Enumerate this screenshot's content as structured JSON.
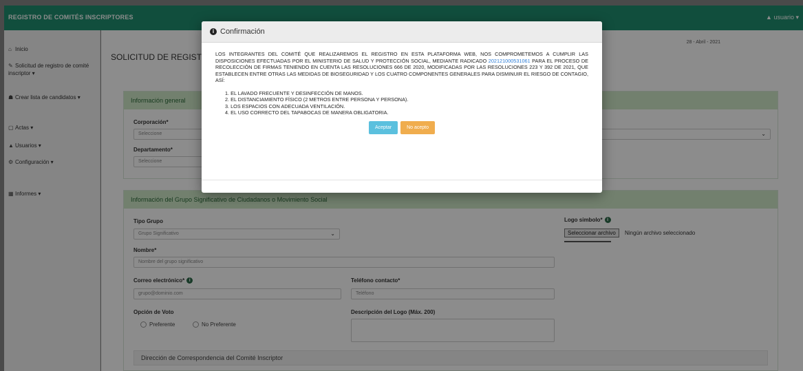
{
  "topbar": {
    "brand": "REGISTRO DE COMITÉS INSCRIPTORES",
    "user": "▲ usuario ▾"
  },
  "sidebar": {
    "items": [
      {
        "icon": "home-icon",
        "glyph": "⌂",
        "label": "Inicio"
      },
      {
        "icon": "edit-icon",
        "glyph": "✎",
        "label": "Solicitud de registro de comité inscriptor ▾"
      },
      {
        "icon": "users-icon",
        "glyph": "☗",
        "label": "Crear lista de candidatos ▾"
      },
      {
        "icon": "document-icon",
        "glyph": "▢",
        "label": "Actas ▾"
      },
      {
        "icon": "user-icon",
        "glyph": "▲",
        "label": "Usuarios ▾"
      },
      {
        "icon": "gear-icon",
        "glyph": "⚙",
        "label": "Configuración ▾"
      },
      {
        "icon": "chart-icon",
        "glyph": "▦",
        "label": "Informes ▾"
      }
    ]
  },
  "page": {
    "title": "SOLICITUD DE REGISTRO",
    "date": "28 - Abril - 2021",
    "section1_title": "Información general",
    "corporacion_label": "Corporación*",
    "corporacion_value": "Seleccione",
    "departamento_label": "Departamento*",
    "departamento_value": "Seleccione",
    "section2_title": "Información del Grupo Significativo de Ciudadanos o Movimiento Social",
    "tipo_grupo_label": "Tipo Grupo",
    "tipo_grupo_value": "Grupo Significativo",
    "logo_label": "Logo simbolo*",
    "file_button": "Seleccionar archivo",
    "file_status": "Ningún archivo seleccionado",
    "nombre_label": "Nombre*",
    "nombre_placeholder": "Nombre del grupo significativo",
    "correo_label": "Correo electrónico*",
    "correo_placeholder": "grupo@dominio.com",
    "telefono_label": "Teléfono contacto*",
    "telefono_placeholder": "Teléfono",
    "opcion_voto_label": "Opción de Voto",
    "opcion_preferente": "Preferente",
    "opcion_no_preferente": "No Preferente",
    "descripcion_label": "Descripción del Logo (Máx. 200)",
    "direccion_title": "Dirección de Correspondencia del Comité Inscriptor"
  },
  "modal": {
    "title": "Confirmación",
    "text_before_link": "LOS INTEGRANTES DEL COMITÉ QUE REALIZAREMOS EL REGISTRO EN ESTA PLATAFORMA WEB, NOS COMPROMETEMOS A CUMPLIR LAS DISPOSICIONES EFECTUADAS POR EL MINISTERIO DE SALUD Y PROTECCIÓN SOCIAL, MEDIANTE RADICADO ",
    "link": "202121000531061",
    "text_after_link": " PARA EL PROCESO DE RECOLECCIÓN DE FIRMAS TENIENDO EN CUENTA LAS RESOLUCIONES 666 DE 2020, MODIFICADAS POR LAS RESOLUCIONES 223 Y 392 DE 2021, QUE ESTABLECEN ENTRE OTRAS LAS MEDIDAS DE BIOSEGURIDAD Y LOS CUATRO COMPONENTES GENERALES PARA DISMINUIR EL RIESGO DE CONTAGIO, ASÍ:",
    "items": [
      "1. EL LAVADO FRECUENTE Y DESINFECCIÓN DE MANOS.",
      "2. EL DISTANCIAMIENTO FÍSICO (2 METROS ENTRE PERSONA Y PERSONA).",
      "3. LOS ESPACIOS CON ADECUADA VENTILACIÓN.",
      "4. EL USO CORRECTO DEL TAPABOCAS DE MANERA OBLIGATORIA."
    ],
    "accept": "Aceptar",
    "reject": "No acepto"
  }
}
